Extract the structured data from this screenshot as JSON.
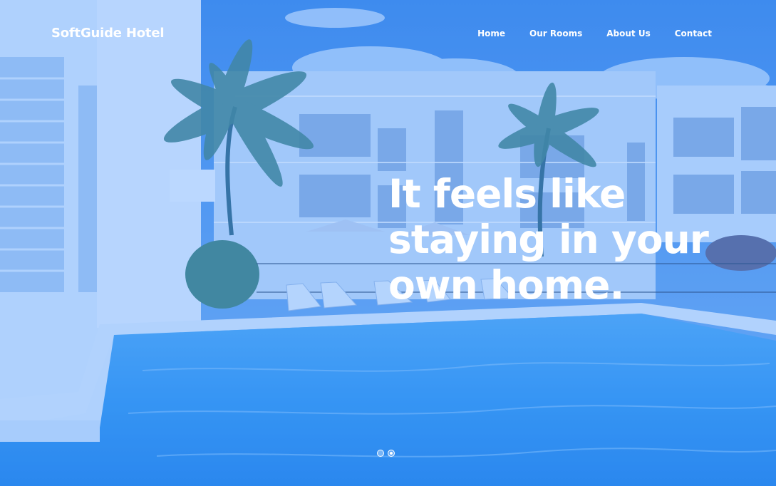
{
  "brand": {
    "name": "SoftGuide Hotel"
  },
  "nav": {
    "items": [
      {
        "label": "Home"
      },
      {
        "label": "Our Rooms"
      },
      {
        "label": "About Us"
      },
      {
        "label": "Contact"
      }
    ]
  },
  "hero": {
    "headline_lines": [
      "It feels like",
      "staying in your",
      "own home."
    ],
    "slides_total": 2,
    "slide_active": 2,
    "overlay_color": "#2180ff"
  }
}
